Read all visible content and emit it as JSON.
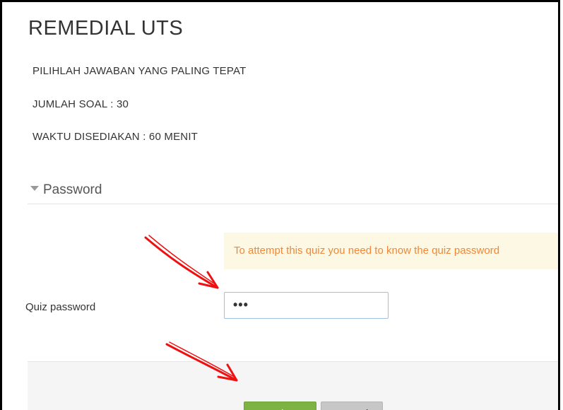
{
  "page": {
    "title": "REMEDIAL UTS",
    "info": [
      "PILIHLAH JAWABAN YANG PALING TEPAT",
      "JUMLAH SOAL : 30",
      "WAKTU DISEDIAKAN : 60 MENIT"
    ]
  },
  "password_section": {
    "legend": "Password",
    "notice": "To attempt this quiz you need to know the quiz password",
    "field_label": "Quiz password",
    "field_value": "•••"
  },
  "actions": {
    "continue_label": "Continue",
    "cancel_label": "Cancel"
  },
  "colors": {
    "continue_button": "#7cb342",
    "cancel_button": "#c7c7c7",
    "notice_bg": "#fcf8e3",
    "notice_text": "#f0883a",
    "annotation_arrow": "#ee1111"
  }
}
